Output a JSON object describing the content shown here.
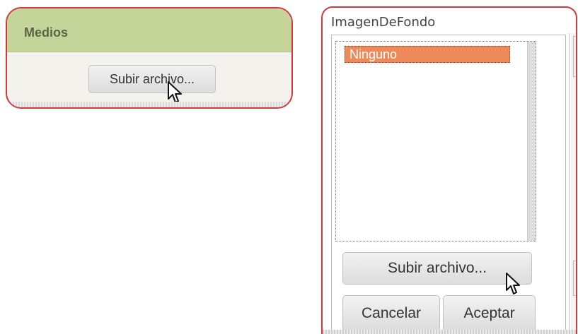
{
  "media_panel": {
    "title": "Medios",
    "upload_button_label": "Subir archivo..."
  },
  "background_panel": {
    "title": "ImagenDeFondo",
    "list_items": [
      "Ninguno"
    ],
    "selected_item": "Ninguno",
    "upload_button_label": "Subir archivo...",
    "cancel_button_label": "Cancelar",
    "accept_button_label": "Aceptar"
  },
  "colors": {
    "highlight_border": "#cf3b3b",
    "media_header_bg": "#c5d59a",
    "selected_item_bg": "#ee8a5a"
  },
  "icons": {
    "cursor": "mouse-pointer-icon"
  }
}
